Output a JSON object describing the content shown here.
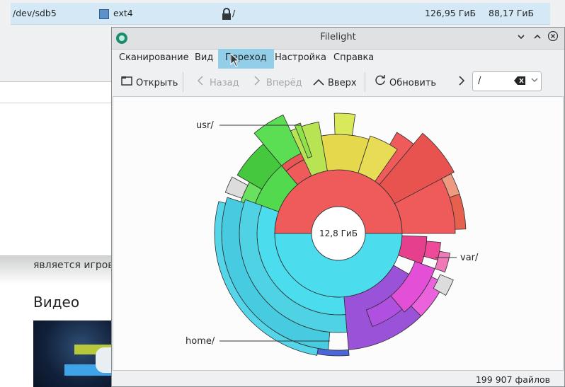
{
  "background": {
    "partition": {
      "device": "/dev/sdb5",
      "filesystem": "ext4",
      "mountpoint": "/",
      "size": "126,95 ГиБ",
      "used": "88,17 ГиБ"
    },
    "web": {
      "text": "является игровой",
      "heading": "Видео"
    }
  },
  "window": {
    "title": "Filelight",
    "menu": [
      "Сканирование",
      "Вид",
      "Переход",
      "Настройка",
      "Справка"
    ],
    "active_menu": "Переход",
    "toolbar": {
      "open": "Открыть",
      "back": "Назад",
      "forward": "Вперёд",
      "up": "Вверх",
      "refresh": "Обновить"
    },
    "path": {
      "value": "/"
    },
    "center_label": "12,8 ГиБ",
    "labels": {
      "usr": "usr/",
      "var": "var/",
      "home": "home/"
    },
    "status": "199 907 файлов"
  },
  "colors": {
    "usr": "#ef5a5a",
    "green": "#53d94d",
    "yellow": "#e6d84c",
    "home": "#4bdced",
    "blue": "#4a66d8",
    "purple": "#9a52d8",
    "magenta": "#e34fd6",
    "pink": "#e63f8e",
    "grey": "#dcdcdc"
  },
  "icons": [
    "app-icon",
    "minimize-icon",
    "maximize-icon",
    "close-icon",
    "folder-open-icon",
    "back-icon",
    "forward-icon",
    "up-icon",
    "refresh-icon",
    "more-icon",
    "clear-icon",
    "dropdown-icon",
    "lock-icon"
  ]
}
